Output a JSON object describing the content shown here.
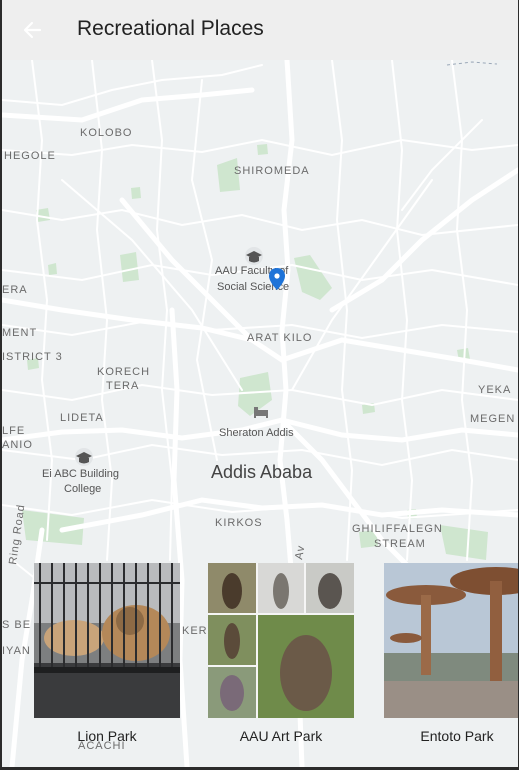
{
  "appbar": {
    "title": "Recreational Places",
    "back_icon": "arrow-back-icon"
  },
  "map": {
    "labels": {
      "kolobo": "KOLOBO",
      "shegole": "HEGOLE",
      "shiromeda": "SHIROMEDA",
      "aau_faculty": "AAU Faculty of",
      "aau_faculty2": "Social Science",
      "era": "ERA",
      "ment": "MENT",
      "arat_kilo": "ARAT KILO",
      "district": "ISTRICT 3",
      "korech": "KORECH",
      "tera": "TERA",
      "lideta": "LIDETA",
      "alfe": "LFE",
      "anio": "ANIO",
      "sheraton": "Sheraton Addis",
      "ei_abc": "Ei ABC Building",
      "college": "College",
      "addis": "Addis Ababa",
      "yeka": "YEKA",
      "megen": "MEGEN",
      "kirkos": "KIRKOS",
      "ghiliffalegn": "GHILIFFALEGN",
      "stream": "STREAM",
      "ring_road": "Ring Road",
      "av": "Av",
      "s_be": "S BE",
      "iyan": "IYAN",
      "ker": "KER",
      "acachi": "ACACHI"
    },
    "colors": {
      "land": "#eef1f2",
      "road": "#ffffff",
      "park": "#cfe6cf",
      "pin": "#1e73d8"
    }
  },
  "cards": [
    {
      "name": "Lion Park"
    },
    {
      "name": "AAU Art Park"
    },
    {
      "name": "Entoto Park"
    }
  ]
}
